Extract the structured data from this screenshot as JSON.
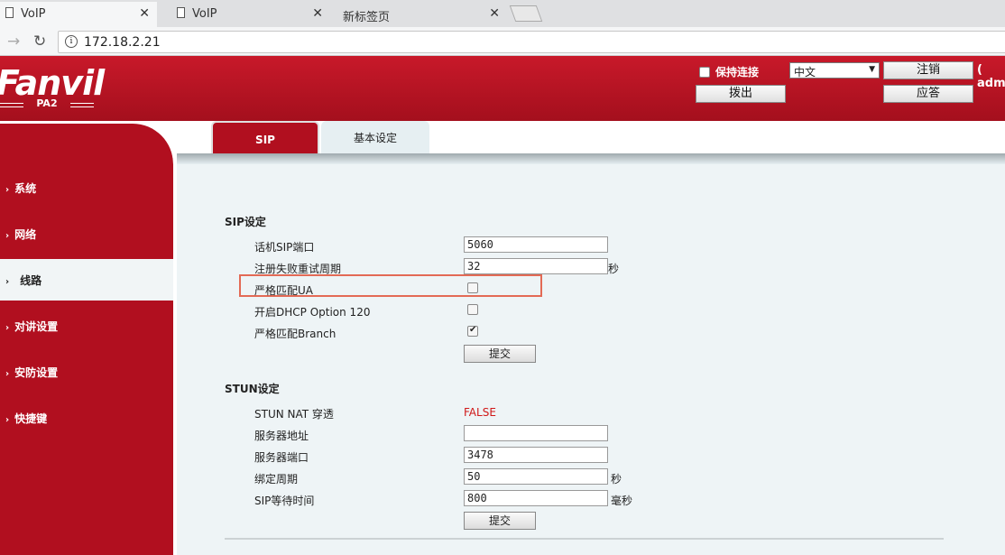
{
  "browser": {
    "tabs": [
      {
        "label": "VoIP",
        "close": "✕"
      },
      {
        "label": "VoIP",
        "close": "✕"
      },
      {
        "label": "新标签页",
        "close": "✕"
      }
    ],
    "url": "172.18.2.21"
  },
  "header": {
    "logo": "Fanvil",
    "model": "PA2",
    "keep_connection": "保持连接",
    "language": "中文",
    "logout": "注销",
    "hangup": "拨出",
    "answer": "应答",
    "user": "( adm"
  },
  "sidebar": {
    "items": [
      {
        "label": "系统"
      },
      {
        "label": "网络"
      },
      {
        "label": "线路"
      },
      {
        "label": "对讲设置"
      },
      {
        "label": "安防设置"
      },
      {
        "label": "快捷键"
      }
    ],
    "active_index": 2
  },
  "tabs": [
    {
      "label": "SIP"
    },
    {
      "label": "基本设定"
    }
  ],
  "sip": {
    "title": "SIP设定",
    "port_label": "话机SIP端口",
    "port_value": "5060",
    "retry_label": "注册失败重试周期",
    "retry_value": "32",
    "retry_unit": "秒",
    "strict_ua_label": "严格匹配UA",
    "strict_ua_checked": false,
    "dhcp120_label": "开启DHCP Option 120",
    "dhcp120_checked": false,
    "strict_branch_label": "严格匹配Branch",
    "strict_branch_checked": true,
    "submit": "提交"
  },
  "stun": {
    "title": "STUN设定",
    "nat_label": "STUN NAT 穿透",
    "nat_value": "FALSE",
    "server_label": "服务器地址",
    "server_value": "",
    "port_label": "服务器端口",
    "port_value": "3478",
    "bind_label": "绑定周期",
    "bind_value": "50",
    "bind_unit": "秒",
    "wait_label": "SIP等待时间",
    "wait_value": "800",
    "wait_unit": "毫秒",
    "submit": "提交"
  },
  "colors": {
    "brand_red": "#b10f1f",
    "false_red": "#d01818",
    "highlight_box": "#e36a55"
  }
}
